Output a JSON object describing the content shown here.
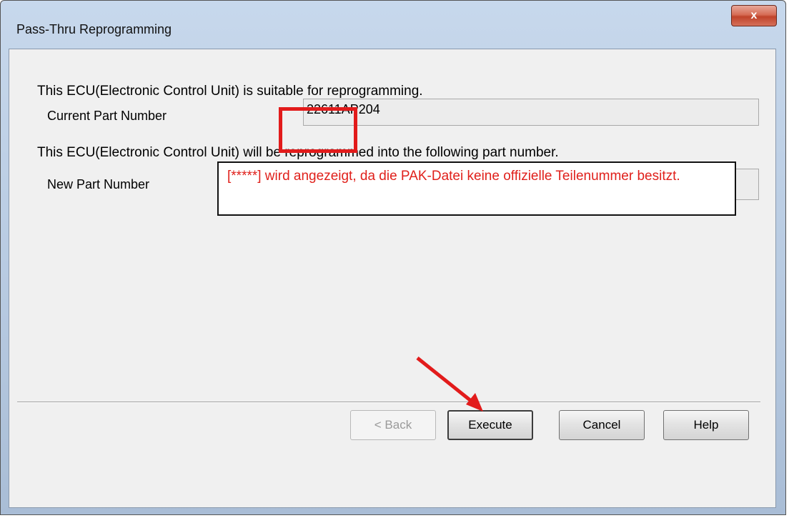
{
  "window": {
    "title": "Pass-Thru Reprogramming",
    "close_glyph": "x"
  },
  "main": {
    "suitable_message": "This ECU(Electronic Control Unit) is suitable for reprogramming.",
    "current_part_label": "Current Part Number",
    "current_part_value": "22611AP204",
    "reprogram_message": "This ECU(Electronic Control Unit) will be reprogrammed into the following part number.",
    "new_part_label": "New Part Number",
    "new_part_value": "*****"
  },
  "annotation": {
    "text": "[*****] wird angezeigt, da die PAK-Datei keine offizielle Teilenummer besitzt."
  },
  "buttons": {
    "back": "< Back",
    "execute": "Execute",
    "cancel": "Cancel",
    "help": "Help"
  },
  "colors": {
    "annotation_red": "#e0201b",
    "dialog_bg": "#f0f0f0"
  }
}
